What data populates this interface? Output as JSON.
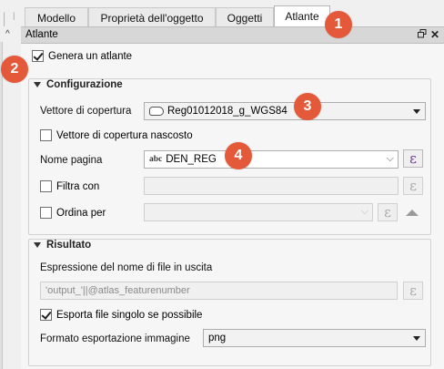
{
  "gutter": {
    "marks": "│ │ │",
    "arrow": "^"
  },
  "tabs": [
    {
      "label": "Modello",
      "active": false
    },
    {
      "label": "Proprietà dell'oggetto",
      "active": false
    },
    {
      "label": "Oggetti",
      "active": false
    },
    {
      "label": "Atlante",
      "active": true
    }
  ],
  "dock": {
    "title": "Atlante",
    "float_icon": "restore-icon",
    "close_icon": "close-icon"
  },
  "generate": {
    "label": "Genera un atlante",
    "checked": true
  },
  "config": {
    "heading": "Configurazione",
    "coverage": {
      "label": "Vettore di copertura",
      "value": "Reg01012018_g_WGS84"
    },
    "hidden": {
      "label": "Vettore di copertura nascosto",
      "checked": false
    },
    "page_name": {
      "label": "Nome pagina",
      "prefix": "abc",
      "value": "DEN_REG"
    },
    "filter": {
      "label": "Filtra con",
      "checked": false,
      "value": ""
    },
    "sort": {
      "label": "Ordina per",
      "checked": false,
      "value": ""
    }
  },
  "output": {
    "heading": "Risultato",
    "expr_label": "Espressione del nome di file in uscita",
    "expr_value": "'output_'||@atlas_featurenumber",
    "single_file": {
      "label": "Esporta file singolo se possibile",
      "checked": true
    },
    "format": {
      "label": "Formato esportazione immagine",
      "value": "png"
    }
  },
  "epsilon_symbol": "ε",
  "badges": [
    "1",
    "2",
    "3",
    "4"
  ],
  "colors": {
    "badge": "#e4593a",
    "expression": "#6b3b8e"
  }
}
